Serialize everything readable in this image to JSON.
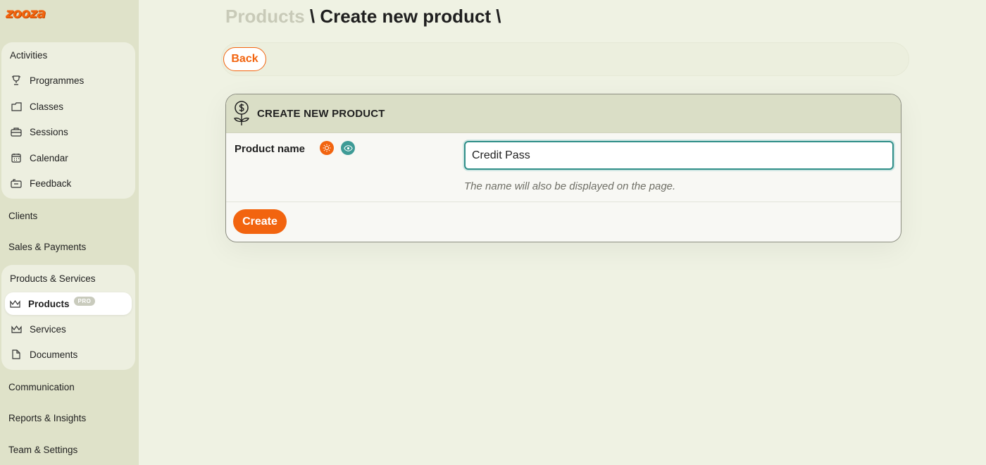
{
  "app": {
    "logo": "zooza"
  },
  "sidebar": {
    "activities_title": "Activities",
    "activities": [
      {
        "label": "Programmes",
        "icon": "trophy-icon"
      },
      {
        "label": "Classes",
        "icon": "folder-icon"
      },
      {
        "label": "Sessions",
        "icon": "briefcase-icon"
      },
      {
        "label": "Calendar",
        "icon": "calendar-icon"
      },
      {
        "label": "Feedback",
        "icon": "feedback-icon"
      }
    ],
    "clients": "Clients",
    "sales": "Sales & Payments",
    "products_title": "Products & Services",
    "products": [
      {
        "label": "Products",
        "icon": "crown-icon",
        "badge": "PRO",
        "active": true
      },
      {
        "label": "Services",
        "icon": "crown-icon"
      },
      {
        "label": "Documents",
        "icon": "document-icon"
      }
    ],
    "communication": "Communication",
    "reports": "Reports & Insights",
    "team": "Team & Settings"
  },
  "breadcrumb": {
    "parent": "Products",
    "separator": " \\ ",
    "current": "Create new product",
    "trailing": " \\"
  },
  "toolbar": {
    "back_label": "Back"
  },
  "card": {
    "icon": "money-flower-icon",
    "title": "CREATE NEW PRODUCT",
    "field_label": "Product name",
    "field_value": "Credit Pass",
    "helper": "The name will also be displayed on the page.",
    "create_label": "Create"
  },
  "colors": {
    "accent": "#f2640f",
    "teal": "#3e9b96",
    "sidebar_bg": "#dfe2c9",
    "page_bg": "#eff2e3"
  }
}
